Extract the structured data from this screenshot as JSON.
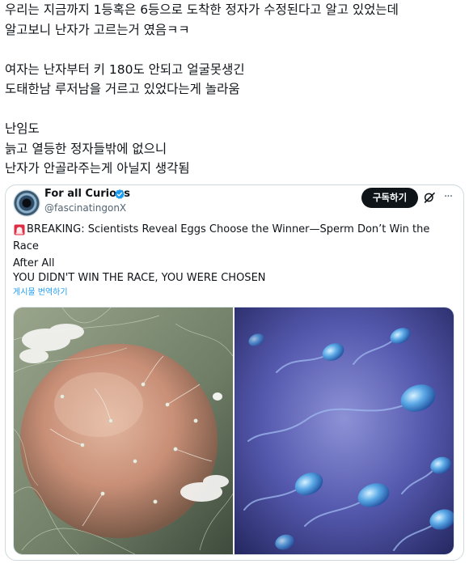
{
  "post": {
    "lines": [
      "우리는 지금까지 1등혹은 6등으로 도착한 정자가 수정된다고 알고 있었는데",
      "알고보니 난자가 고르는거 였음ㅋㅋ",
      "",
      "여자는 난자부터 키 180도 안되고 얼굴못생긴",
      "도태한남 루저남을 거르고 있었다는게 놀라움",
      "",
      "난임도",
      "늙고 열등한 정자들밖에 없으니",
      "난자가 안골라주는게 아닐지 생각됨"
    ]
  },
  "quote": {
    "author_name": "For all Curious",
    "author_handle": "@fascinatingonX",
    "subscribe_label": "구독하기",
    "more_label": "···",
    "headline_line1": "BREAKING: Scientists Reveal Eggs Choose the Winner—Sperm Don’t Win the Race",
    "headline_line2": "After All",
    "subheadline": "YOU DIDN'T WIN THE RACE, YOU WERE CHOSEN",
    "translate_label": "게시물 번역하기",
    "icons": {
      "verified": "verified-badge-icon",
      "grok": "grok-icon",
      "more": "more-icon",
      "siren": "siren-icon"
    },
    "colors": {
      "verified": "#1d9bf0",
      "link": "#1d9bf0",
      "button": "#0f1419"
    }
  }
}
